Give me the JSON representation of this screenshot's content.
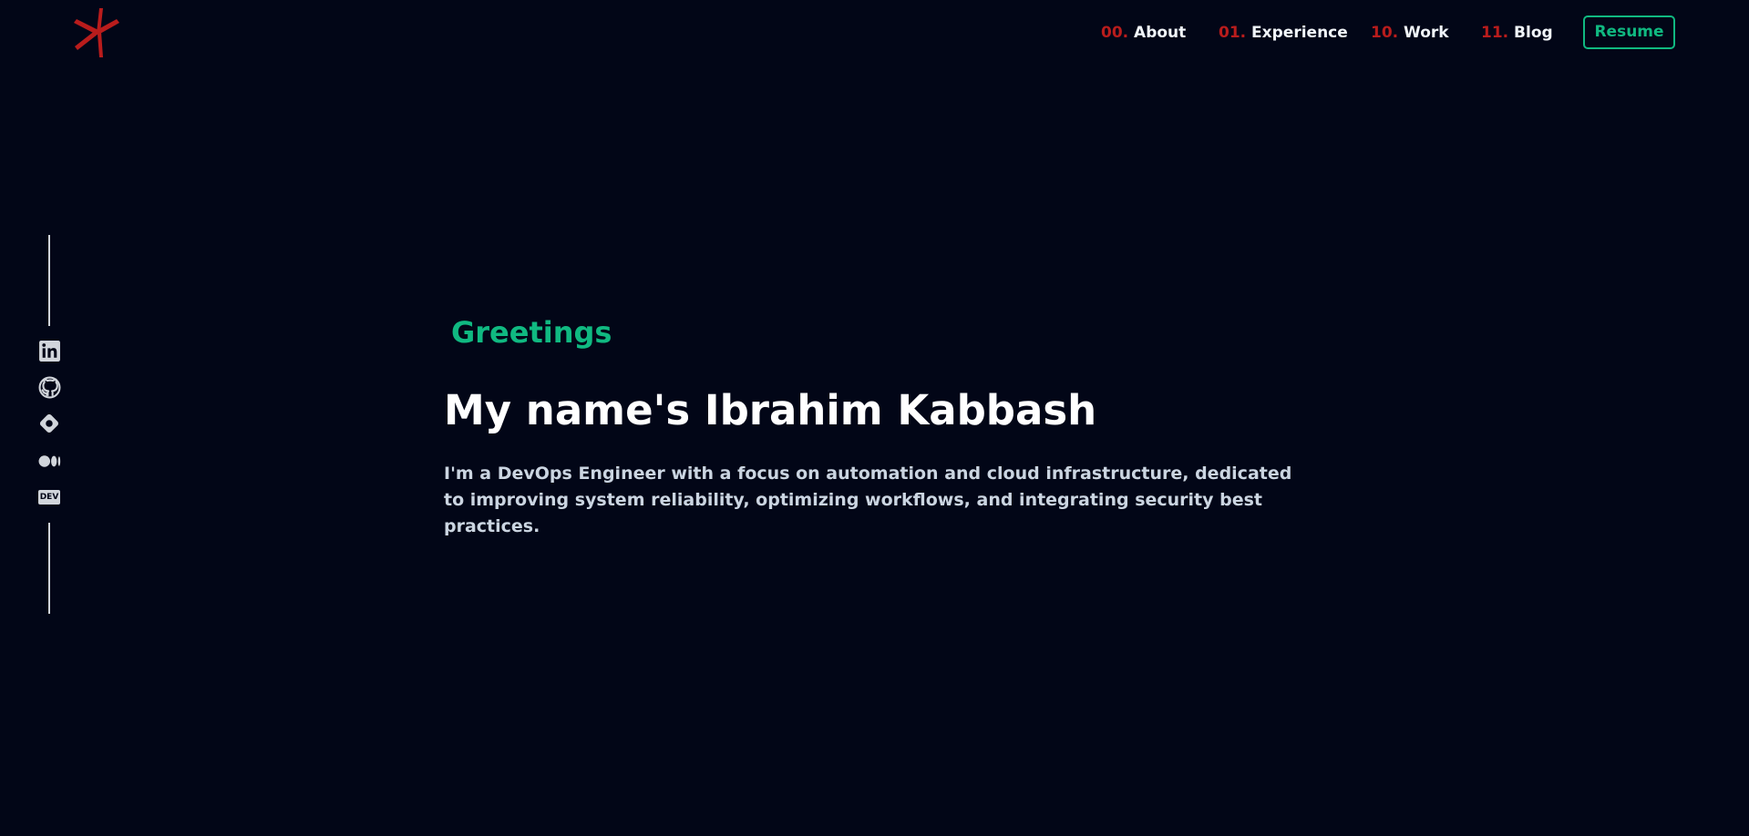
{
  "header": {
    "logo_icon": "asterisk-logo-icon",
    "accent_color": "#b91c1c",
    "nav": [
      {
        "number": "00.",
        "label": "About"
      },
      {
        "number": "01.",
        "label": "Experience"
      },
      {
        "number": "10.",
        "label": "Work"
      },
      {
        "number": "11.",
        "label": "Blog"
      }
    ],
    "resume_label": "Resume"
  },
  "social_links": [
    {
      "icon": "linkedin-icon"
    },
    {
      "icon": "github-icon"
    },
    {
      "icon": "hashnode-icon"
    },
    {
      "icon": "medium-icon"
    },
    {
      "icon": "dev-icon",
      "text": "DEV"
    }
  ],
  "hero": {
    "greeting": "Greetings",
    "title": "My name's Ibrahim Kabbash",
    "description": "I'm a DevOps Engineer with a focus on automation and cloud infrastructure, dedicated to improving system reliability, optimizing workflows, and integrating security best practices."
  },
  "colors": {
    "background": "#020617",
    "green_accent": "#10b981",
    "red_accent": "#b91c1c"
  }
}
